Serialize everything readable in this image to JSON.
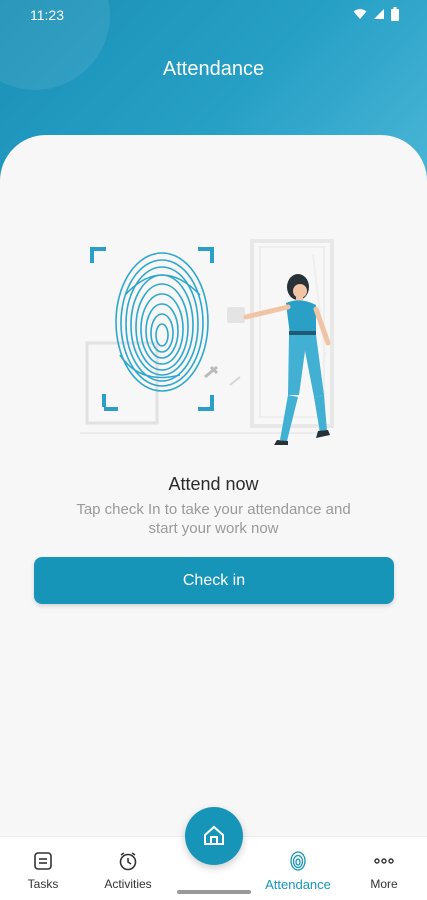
{
  "status_bar": {
    "time": "11:23",
    "wifi_icon": "wifi-icon",
    "signal_icon": "signal-icon",
    "battery_icon": "battery-icon"
  },
  "header": {
    "title": "Attendance"
  },
  "main": {
    "heading": "Attend now",
    "subtext": "Tap check In to take your attendance and start your work now",
    "check_in_label": "Check in",
    "illustration_icon": "fingerprint-scan-illustration"
  },
  "bottom_nav": {
    "items": [
      {
        "label": "Tasks",
        "icon": "tasks-icon"
      },
      {
        "label": "Activities",
        "icon": "clock-icon"
      },
      {
        "label": "Attendance",
        "icon": "fingerprint-icon",
        "active": true
      },
      {
        "label": "More",
        "icon": "more-dots-icon"
      }
    ],
    "fab_icon": "home-icon"
  },
  "colors": {
    "accent": "#1795b9",
    "header_gradient_start": "#1a8fb6",
    "header_gradient_end": "#4bb6d6"
  }
}
